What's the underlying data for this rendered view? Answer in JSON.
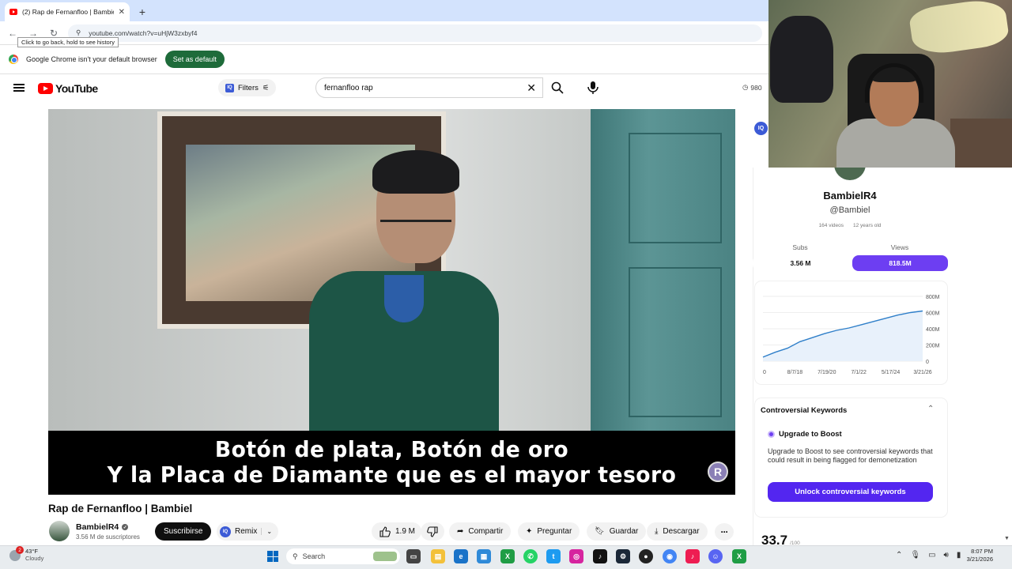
{
  "browser": {
    "tab_title": "(2) Rap de Fernanfloo | Bambiel",
    "url": "youtube.com/watch?v=uHjW3zxbyf4",
    "back_tooltip": "Click to go back, hold to see history",
    "infobar_text": "Google Chrome isn't your default browser",
    "set_default_label": "Set as default"
  },
  "youtube": {
    "logo_text": "YouTube",
    "filters_label": "Filters",
    "search_value": "fernanfloo rap",
    "header_count": "980"
  },
  "video": {
    "caption_line1": "Botón de plata, Botón de oro",
    "caption_line2": "Y la Placa de Diamante que es el mayor tesoro",
    "watermark": "R",
    "title": "Rap de Fernanfloo | Bambiel",
    "channel_name": "BambielR4",
    "channel_subs": "3.56 M de suscriptores",
    "subscribe_label": "Suscribirse",
    "remix_label": "Remix",
    "likes": "1.9 M",
    "share_label": "Compartir",
    "ask_label": "Preguntar",
    "save_label": "Guardar",
    "download_label": "Descargar"
  },
  "panel": {
    "name": "BambielR4",
    "handle": "@Bambiel",
    "videos": "164 videos",
    "age": "12 years old",
    "subs_label": "Subs",
    "subs_value": "3.56 M",
    "views_label": "Views",
    "views_value": "818.5M",
    "controversial_title": "Controversial Keywords",
    "boost_label": "Upgrade to Boost",
    "boost_desc": "Upgrade to Boost to see controversial keywords that could result in being flagged for demonetization",
    "unlock_label": "Unlock controversial keywords",
    "score_value": "33.7",
    "score_max": "/100"
  },
  "chart_data": {
    "type": "line",
    "x_tick_labels": [
      "0",
      "8/7/18",
      "7/19/20",
      "7/1/22",
      "5/17/24",
      "3/21/26"
    ],
    "y_tick_labels": [
      "800M",
      "600M",
      "400M",
      "200M",
      "0"
    ],
    "ylim": [
      0,
      800
    ],
    "series": [
      {
        "values": [
          50,
          110,
          160,
          240,
          290,
          340,
          380,
          410,
          450,
          490,
          530,
          570,
          600,
          620
        ]
      }
    ],
    "color": "#2f7fc9"
  },
  "taskbar": {
    "weather_temp": "43°F",
    "weather_desc": "Cloudy",
    "notification_count": "2",
    "search_label": "Search",
    "time": "8:07 PM",
    "date": "3/21/2026"
  }
}
